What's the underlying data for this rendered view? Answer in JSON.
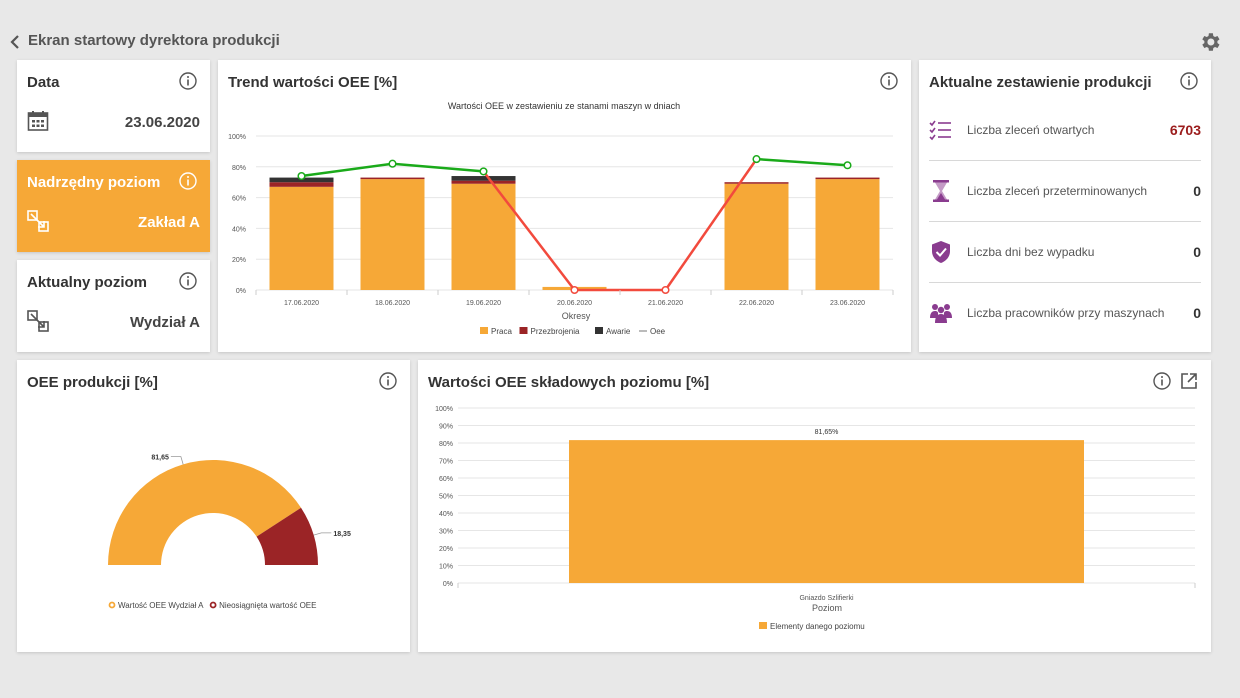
{
  "header": {
    "title": "Ekran startowy dyrektora produkcji"
  },
  "date_card": {
    "title": "Data",
    "value": "23.06.2020"
  },
  "parent_level_card": {
    "title": "Nadrzędny poziom",
    "value": "Zakład A"
  },
  "current_level_card": {
    "title": "Aktualny poziom",
    "value": "Wydział A"
  },
  "trend_card": {
    "title": "Trend wartości OEE [%]"
  },
  "production_card": {
    "title": "Aktualne zestawienie produkcji",
    "rows": [
      {
        "label": "Liczba zleceń otwartych",
        "value": "6703",
        "value_color": "#9b1c1c",
        "icon": "checklist-icon"
      },
      {
        "label": "Liczba zleceń przeterminowanych",
        "value": "0",
        "value_color": "#333333",
        "icon": "hourglass-icon"
      },
      {
        "label": "Liczba dni bez wypadku",
        "value": "0",
        "value_color": "#333333",
        "icon": "shield-check-icon"
      },
      {
        "label": "Liczba pracowników przy maszynach",
        "value": "0",
        "value_color": "#333333",
        "icon": "people-icon"
      }
    ]
  },
  "oee_card": {
    "title": "OEE produkcji [%]"
  },
  "components_card": {
    "title": "Wartości OEE składowych poziomu [%]"
  },
  "colors": {
    "accent": "#f6a837",
    "dark_red": "#9b2426",
    "dark": "#333333",
    "green": "#1aaa1a",
    "red": "#f24a3d",
    "purple": "#8a3c8f"
  },
  "chart_data": [
    {
      "type": "bar",
      "title": "Wartości OEE w zestawieniu ze stanami maszyn w dniach",
      "xlabel": "Okresy",
      "ylabel": "",
      "ylim": [
        0,
        100
      ],
      "yticks": [
        "0%",
        "20%",
        "40%",
        "60%",
        "80%",
        "100%"
      ],
      "categories": [
        "17.06.2020",
        "18.06.2020",
        "19.06.2020",
        "20.06.2020",
        "21.06.2020",
        "22.06.2020",
        "23.06.2020"
      ],
      "stacked": true,
      "series": [
        {
          "name": "Praca",
          "color": "#f6a837",
          "values": [
            67,
            72,
            69,
            2,
            0,
            69,
            72
          ]
        },
        {
          "name": "Przezbrojenia",
          "color": "#9b2426",
          "values": [
            3,
            1,
            2,
            0,
            0,
            1,
            1
          ]
        },
        {
          "name": "Awarie",
          "color": "#333333",
          "values": [
            3,
            0,
            3,
            0,
            0,
            0,
            0
          ]
        }
      ],
      "line": {
        "name": "Oee",
        "values": [
          74,
          82,
          77,
          0,
          0,
          85,
          81
        ]
      },
      "legend": "bottom"
    },
    {
      "type": "pie",
      "subtype": "half-donut",
      "values": [
        81.65,
        18.35
      ],
      "labels": [
        "Wartość OEE Wydział A",
        "Nieosiągnięta wartość OEE"
      ],
      "value_labels": [
        "81,65",
        "18,35"
      ],
      "colors": [
        "#f6a837",
        "#9b2426"
      ],
      "legend": "bottom"
    },
    {
      "type": "bar",
      "xlabel": "Poziom",
      "ylabel": "",
      "ylim": [
        0,
        100
      ],
      "yticks": [
        "0%",
        "10%",
        "20%",
        "30%",
        "40%",
        "50%",
        "60%",
        "70%",
        "80%",
        "90%",
        "100%"
      ],
      "categories": [
        "Gniazdo Szlifierki"
      ],
      "series": [
        {
          "name": "Elementy danego poziomu",
          "color": "#f6a837",
          "values": [
            81.65
          ]
        }
      ],
      "value_labels": [
        "81,65%"
      ],
      "legend": "bottom"
    }
  ]
}
